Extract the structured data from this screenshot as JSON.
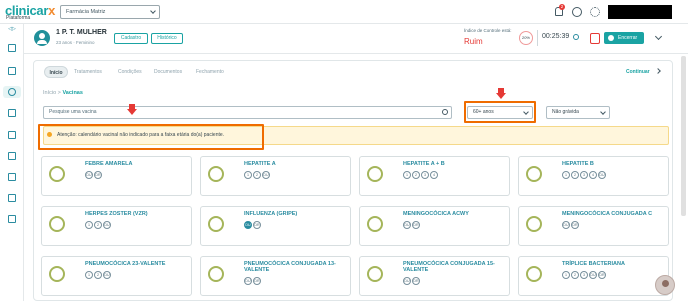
{
  "app": {
    "logo_main": "clinicar",
    "logo_x": "x",
    "logo_sub": "Plataforma",
    "pharmacy_select": "Farmácia Matriz",
    "notification_count": "2"
  },
  "patient": {
    "name": "1 P. T. MULHER",
    "info": "23 anos · Feminino",
    "btn_cadastro": "Cadastro",
    "btn_historico": "Histórico",
    "control_label": "Índice de Controle está:",
    "control_value": "Ruim",
    "control_pct": "20%",
    "timer": "00:25:39",
    "btn_encerrar": "Encerrar"
  },
  "tabs": [
    "Início",
    "Tratamentos",
    "Condições",
    "Documentos",
    "Fechamento"
  ],
  "continuar": "Continuar",
  "breadcrumb": {
    "root": "Início",
    "sep": " > ",
    "current": "Vacinas"
  },
  "search": {
    "placeholder": "Pesquise uma vacina"
  },
  "filters": {
    "age": "60+ anos",
    "pregnancy": "Não grávida"
  },
  "warning": "Atenção: calendário vacinal não indicado para a faixa etária do(a) paciente.",
  "vaccines": [
    {
      "name": "FEBRE AMARELA",
      "doses": [
        {
          "l": "DU",
          "on": false
        },
        {
          "l": "DR",
          "on": false
        }
      ]
    },
    {
      "name": "HEPATITE A",
      "doses": [
        {
          "l": "1",
          "on": false
        },
        {
          "l": "2",
          "on": false
        },
        {
          "l": "DU",
          "on": false
        }
      ]
    },
    {
      "name": "HEPATITE A + B",
      "doses": [
        {
          "l": "1",
          "on": false
        },
        {
          "l": "2",
          "on": false
        },
        {
          "l": "3",
          "on": false
        },
        {
          "l": "4",
          "on": false
        }
      ]
    },
    {
      "name": "HEPATITE B",
      "doses": [
        {
          "l": "1",
          "on": false
        },
        {
          "l": "2",
          "on": false
        },
        {
          "l": "3",
          "on": false
        },
        {
          "l": "4",
          "on": false
        },
        {
          "l": "DU",
          "on": false
        }
      ]
    },
    {
      "name": "HERPES ZOSTER (VZR)",
      "doses": [
        {
          "l": "1",
          "on": false
        },
        {
          "l": "2",
          "on": false
        },
        {
          "l": "DU",
          "on": false
        }
      ]
    },
    {
      "name": "INFLUENZA (GRIPE)",
      "doses": [
        {
          "l": "DU",
          "on": true
        },
        {
          "l": "DR",
          "on": false
        }
      ]
    },
    {
      "name": "MENINGOCÓCICA ACWY",
      "doses": [
        {
          "l": "DU",
          "on": false
        },
        {
          "l": "DR",
          "on": false
        }
      ]
    },
    {
      "name": "MENINGOCÓCICA CONJUGADA C",
      "doses": [
        {
          "l": "DU",
          "on": false
        },
        {
          "l": "DR",
          "on": false
        }
      ]
    },
    {
      "name": "PNEUMOCÓCICA 23-VALENTE",
      "doses": [
        {
          "l": "1",
          "on": false
        },
        {
          "l": "2",
          "on": false
        },
        {
          "l": "DU",
          "on": false
        }
      ]
    },
    {
      "name": "PNEUMOCÓCICA CONJUGADA 13-VALENTE",
      "doses": [
        {
          "l": "DU",
          "on": false
        },
        {
          "l": "DR",
          "on": false
        }
      ]
    },
    {
      "name": "PNEUMOCÓCICA CONJUGADA 15-VALENTE",
      "doses": [
        {
          "l": "DU",
          "on": false
        },
        {
          "l": "DR",
          "on": false
        }
      ]
    },
    {
      "name": "TRÍPLICE BACTERIANA",
      "doses": [
        {
          "l": "1",
          "on": false
        },
        {
          "l": "2",
          "on": false
        },
        {
          "l": "3",
          "on": false
        },
        {
          "l": "DU",
          "on": false
        },
        {
          "l": "DR",
          "on": false
        }
      ]
    }
  ],
  "colors": {
    "brand": "#1aa3a3",
    "accent": "#f28b30",
    "alert": "#e53935",
    "highlight_box": "#ef6c00"
  },
  "icons": [
    "bell-icon",
    "help-icon",
    "gear-icon",
    "home-icon",
    "chart-icon",
    "pill-icon",
    "calendar-icon",
    "folder-icon",
    "bank-icon",
    "id-card-icon",
    "report-icon",
    "search-icon",
    "clock-icon",
    "trash-icon",
    "power-icon",
    "chevron-down-icon",
    "chevron-right-icon",
    "warning-icon"
  ]
}
